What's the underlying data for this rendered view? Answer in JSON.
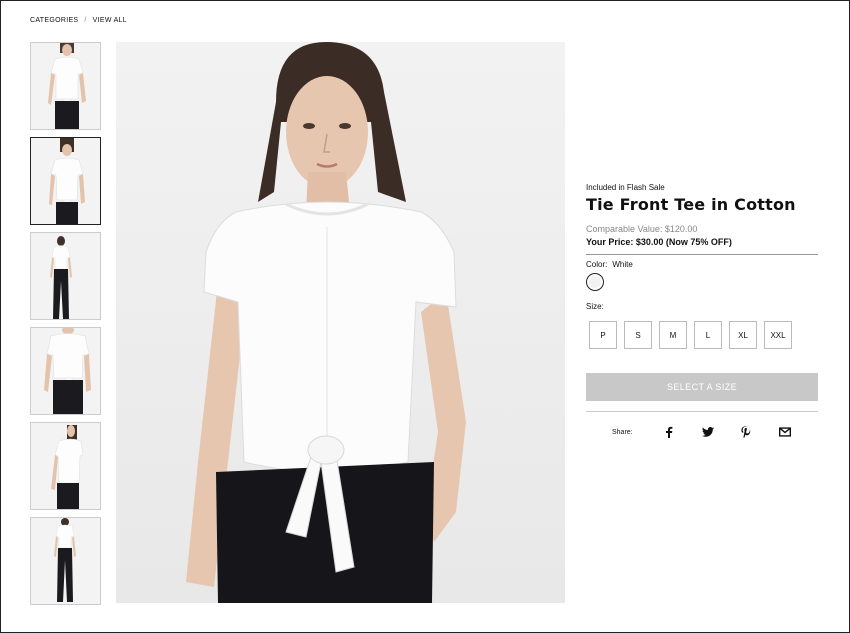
{
  "breadcrumb": {
    "items": [
      "CATEGORIES",
      "VIEW ALL"
    ],
    "separator": "/"
  },
  "gallery": {
    "thumbnails": [
      {
        "alt": "front-tied"
      },
      {
        "alt": "front-full"
      },
      {
        "alt": "back-full"
      },
      {
        "alt": "front-crop"
      },
      {
        "alt": "side"
      },
      {
        "alt": "full-length"
      }
    ],
    "active_index": 1
  },
  "product": {
    "promo": "Included in Flash Sale",
    "title": "Tie Front Tee in Cotton",
    "comparable_value": "Comparable Value: $120.00",
    "your_price": "Your Price: $30.00 (Now 75% OFF)",
    "color_label": "Color:",
    "color_value": "White",
    "swatch_color": "#f2f2f2",
    "size_label": "Size:",
    "sizes": [
      "P",
      "S",
      "M",
      "L",
      "XL",
      "XXL"
    ],
    "add_button": "SELECT A SIZE",
    "add_button_color": "#c8c8c8"
  },
  "share": {
    "label": "Share:",
    "icons": [
      "facebook-icon",
      "twitter-icon",
      "pinterest-icon",
      "email-icon"
    ]
  }
}
